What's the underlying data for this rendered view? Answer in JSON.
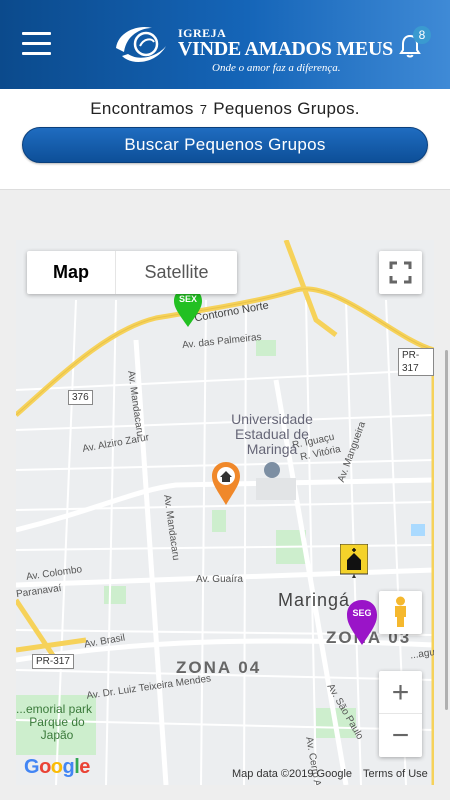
{
  "header": {
    "logo_small": "IGREJA",
    "logo_name": "VINDE AMADOS MEUS",
    "logo_tagline": "Onde o amor faz a diferença.",
    "notification_count": "8"
  },
  "summary": {
    "prefix": "Encontramos",
    "count": "7",
    "suffix": "Pequenos Grupos."
  },
  "search_button_label": "Buscar Pequenos Grupos",
  "map": {
    "type_options": [
      "Map",
      "Satellite"
    ],
    "selected_type": "Map",
    "streets": {
      "contorno_norte": "Contorno Norte",
      "das_palmeiras": "Av. das Palmeiras",
      "mandacaru_top": "Av. Mandacaru",
      "alziro_zarur": "Av. Alziro Zarur",
      "mandacaru_bottom": "Av. Mandacaru",
      "guaira": "Av. Guaíra",
      "colombo": "Av. Colombo",
      "paranavai": "Paranavaí",
      "brasil": "Av. Brasil",
      "luiz_teixeira": "Av. Dr. Luiz Teixeira Mendes",
      "iguacu": "R. Iguaçu",
      "vitoria": "R. Vitória",
      "mangueira": "Av. Mangueira",
      "sao_paulo": "Av. São Paulo",
      "cerro_azul": "Av. Cerro Az...",
      "laguna": "...aguna"
    },
    "university": "Universidade Estadual de Maringá",
    "city": "Maringá",
    "zones": [
      "ZONA 04",
      "ZONA 03"
    ],
    "highways": [
      "PR-317",
      "376",
      "PR-317"
    ],
    "park": "...emorial park",
    "park2": "Parque do Japão",
    "markers": [
      {
        "label": "SEX",
        "color": "#22c022"
      },
      {
        "label": "SEG",
        "color": "#9a14c8"
      }
    ],
    "attribution": "Map data ©2019 Google",
    "terms": "Terms of Use",
    "google": [
      "G",
      "o",
      "o",
      "g",
      "l",
      "e"
    ],
    "google_colors": [
      "#4285f4",
      "#ea4335",
      "#fbbc05",
      "#4285f4",
      "#34a853",
      "#ea4335"
    ]
  }
}
